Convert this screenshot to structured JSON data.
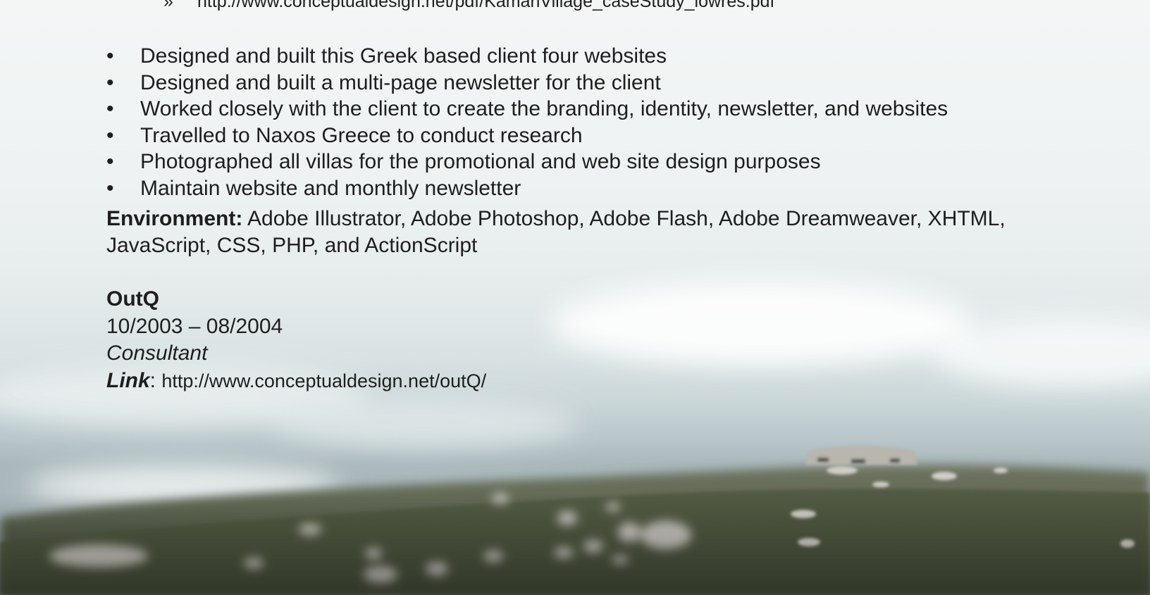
{
  "top_link": {
    "marker": "»",
    "url": "http://www.conceptualdesign.net/pdf/KamariVillage_caseStudy_lowres.pdf"
  },
  "bullet_marker": "•",
  "bullets": [
    "Designed and built this Greek based client four websites",
    "Designed and built a multi-page newsletter for the client",
    "Worked closely with the client to create the branding, identity, newsletter, and websites",
    "Travelled to Naxos Greece to conduct research",
    "Photographed all villas for the promotional and web site design purposes",
    "Maintain website and monthly newsletter"
  ],
  "environment": {
    "label": "Environment:",
    "value": " Adobe Illustrator, Adobe Photoshop, Adobe Flash, Adobe Dreamweaver, XHTML, JavaScript, CSS, PHP, and ActionScript"
  },
  "job": {
    "company": "OutQ",
    "dates": "10/2003 – 08/2004",
    "role": "Consultant",
    "link_label": "Link",
    "link_separator": ": ",
    "link_url": "http://www.conceptualdesign.net/outQ/"
  }
}
